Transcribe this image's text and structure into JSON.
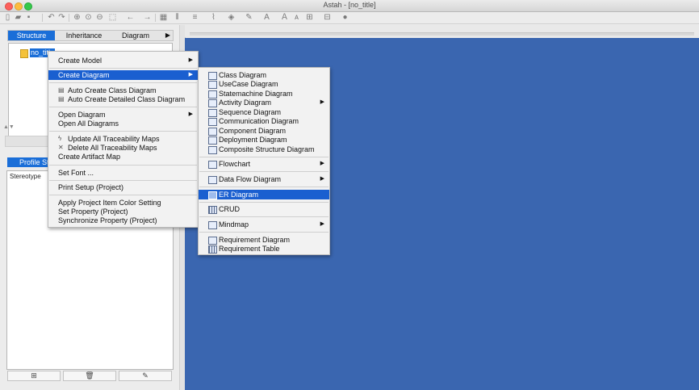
{
  "window": {
    "title": "Astah - [no_title]"
  },
  "left_pane": {
    "tabs": [
      "Structure",
      "Inheritance",
      "Diagram"
    ],
    "tab_more": "▶",
    "tree_root": "no_title",
    "profile_tab": "Profile St",
    "stereotype_label": "Stereotype",
    "bottom_buttons": [
      "add",
      "delete",
      "edit"
    ]
  },
  "context_menu": {
    "create_model": "Create Model",
    "create_diagram": "Create Diagram",
    "auto_create_class_diagram": "Auto Create Class Diagram",
    "auto_create_detailed_class_diagram": "Auto Create Detailed Class Diagram",
    "open_diagram": "Open Diagram",
    "open_all_diagrams": "Open All Diagrams",
    "update_all_traceability_maps": "Update All Traceability Maps",
    "delete_all_traceability_maps": "Delete All Traceability Maps",
    "create_artifact_map": "Create Artifact Map",
    "set_font": "Set Font ...",
    "print_setup": "Print Setup (Project)",
    "apply_project_item_color_setting": "Apply Project Item Color Setting",
    "set_property": "Set Property (Project)",
    "synchronize_property": "Synchronize Property (Project)"
  },
  "submenu": {
    "class_diagram": "Class Diagram",
    "usecase_diagram": "UseCase Diagram",
    "statemachine_diagram": "Statemachine Diagram",
    "activity_diagram": "Activity Diagram",
    "sequence_diagram": "Sequence Diagram",
    "communication_diagram": "Communication Diagram",
    "component_diagram": "Component Diagram",
    "deployment_diagram": "Deployment Diagram",
    "composite_structure_diagram": "Composite Structure Diagram",
    "flowchart": "Flowchart",
    "data_flow_diagram": "Data Flow Diagram",
    "er_diagram": "ER Diagram",
    "crud": "CRUD",
    "mindmap": "Mindmap",
    "requirement_diagram": "Requirement Diagram",
    "requirement_table": "Requirement Table"
  },
  "colors": {
    "canvas": "#3a66b0",
    "highlight": "#1a5fd0",
    "tab_active": "#1a6ed8"
  }
}
